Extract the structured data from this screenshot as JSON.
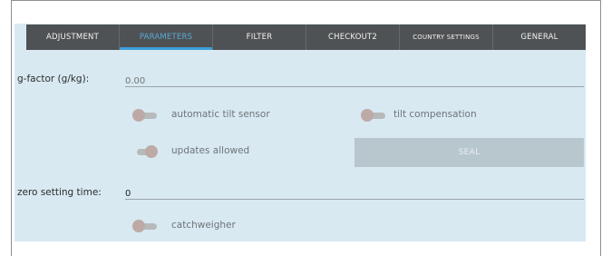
{
  "tabs": [
    {
      "label": "ADJUSTMENT",
      "active": false
    },
    {
      "label": "PARAMETERS",
      "active": true
    },
    {
      "label": "FILTER",
      "active": false
    },
    {
      "label": "CHECKOUT2",
      "active": false
    },
    {
      "label": "COUNTRY SETTINGS",
      "active": false
    },
    {
      "label": "GENERAL",
      "active": false
    }
  ],
  "fields": {
    "gfactor": {
      "label": "g-factor (g/kg):",
      "value": "",
      "placeholder": "0.00"
    },
    "zero_time": {
      "label": "zero setting time:",
      "value": "0",
      "placeholder": ""
    }
  },
  "toggles": {
    "auto_tilt": {
      "label": "automatic tilt sensor",
      "state": "off"
    },
    "tilt_comp": {
      "label": "tilt compensation",
      "state": "off"
    },
    "updates": {
      "label": "updates allowed",
      "state": "on"
    },
    "catchweigher": {
      "label": "catchweigher",
      "state": "off"
    }
  },
  "buttons": {
    "seal": "SEAL"
  },
  "colors": {
    "panel_bg": "#d8e9f2",
    "tab_bg": "#4f5254",
    "tab_active_text": "#5aa9d6",
    "tab_active_indicator": "#3b9fd9",
    "seal_bg": "#b8c7ce"
  }
}
